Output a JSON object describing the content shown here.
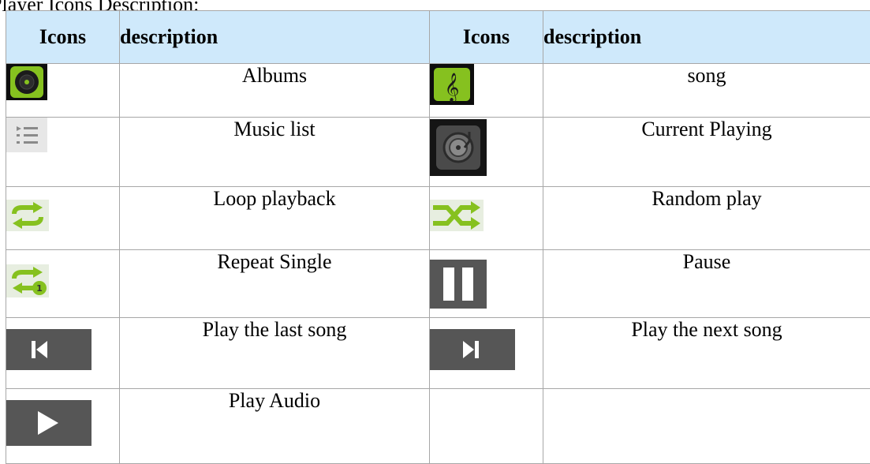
{
  "caption": "e Player Icons Description:",
  "headers": {
    "icons_1": "Icons",
    "description_1": "description",
    "icons_2": "Icons",
    "description_2": "description"
  },
  "rows": [
    {
      "left": {
        "icon": "album-disc-icon",
        "label": "Albums"
      },
      "right": {
        "icon": "song-treble-clef-icon",
        "label": "song"
      }
    },
    {
      "left": {
        "icon": "music-list-icon",
        "label": "Music list"
      },
      "right": {
        "icon": "current-playing-turntable-icon",
        "label": "Current Playing"
      }
    },
    {
      "left": {
        "icon": "loop-playback-icon",
        "label": "Loop playback"
      },
      "right": {
        "icon": "random-play-shuffle-icon",
        "label": "Random play"
      }
    },
    {
      "left": {
        "icon": "repeat-single-icon",
        "label": "Repeat Single"
      },
      "right": {
        "icon": "pause-icon",
        "label": "Pause"
      }
    },
    {
      "left": {
        "icon": "previous-track-icon",
        "label": "Play the last song"
      },
      "right": {
        "icon": "next-track-icon",
        "label": "Play the next song"
      }
    },
    {
      "left": {
        "icon": "play-icon",
        "label": "Play Audio"
      },
      "right": {
        "icon": "",
        "label": ""
      }
    }
  ],
  "colors": {
    "header_bg": "#cfe9fb",
    "border": "#a7a7a7",
    "icon_green": "#86c11f",
    "icon_dark": "#565656"
  }
}
